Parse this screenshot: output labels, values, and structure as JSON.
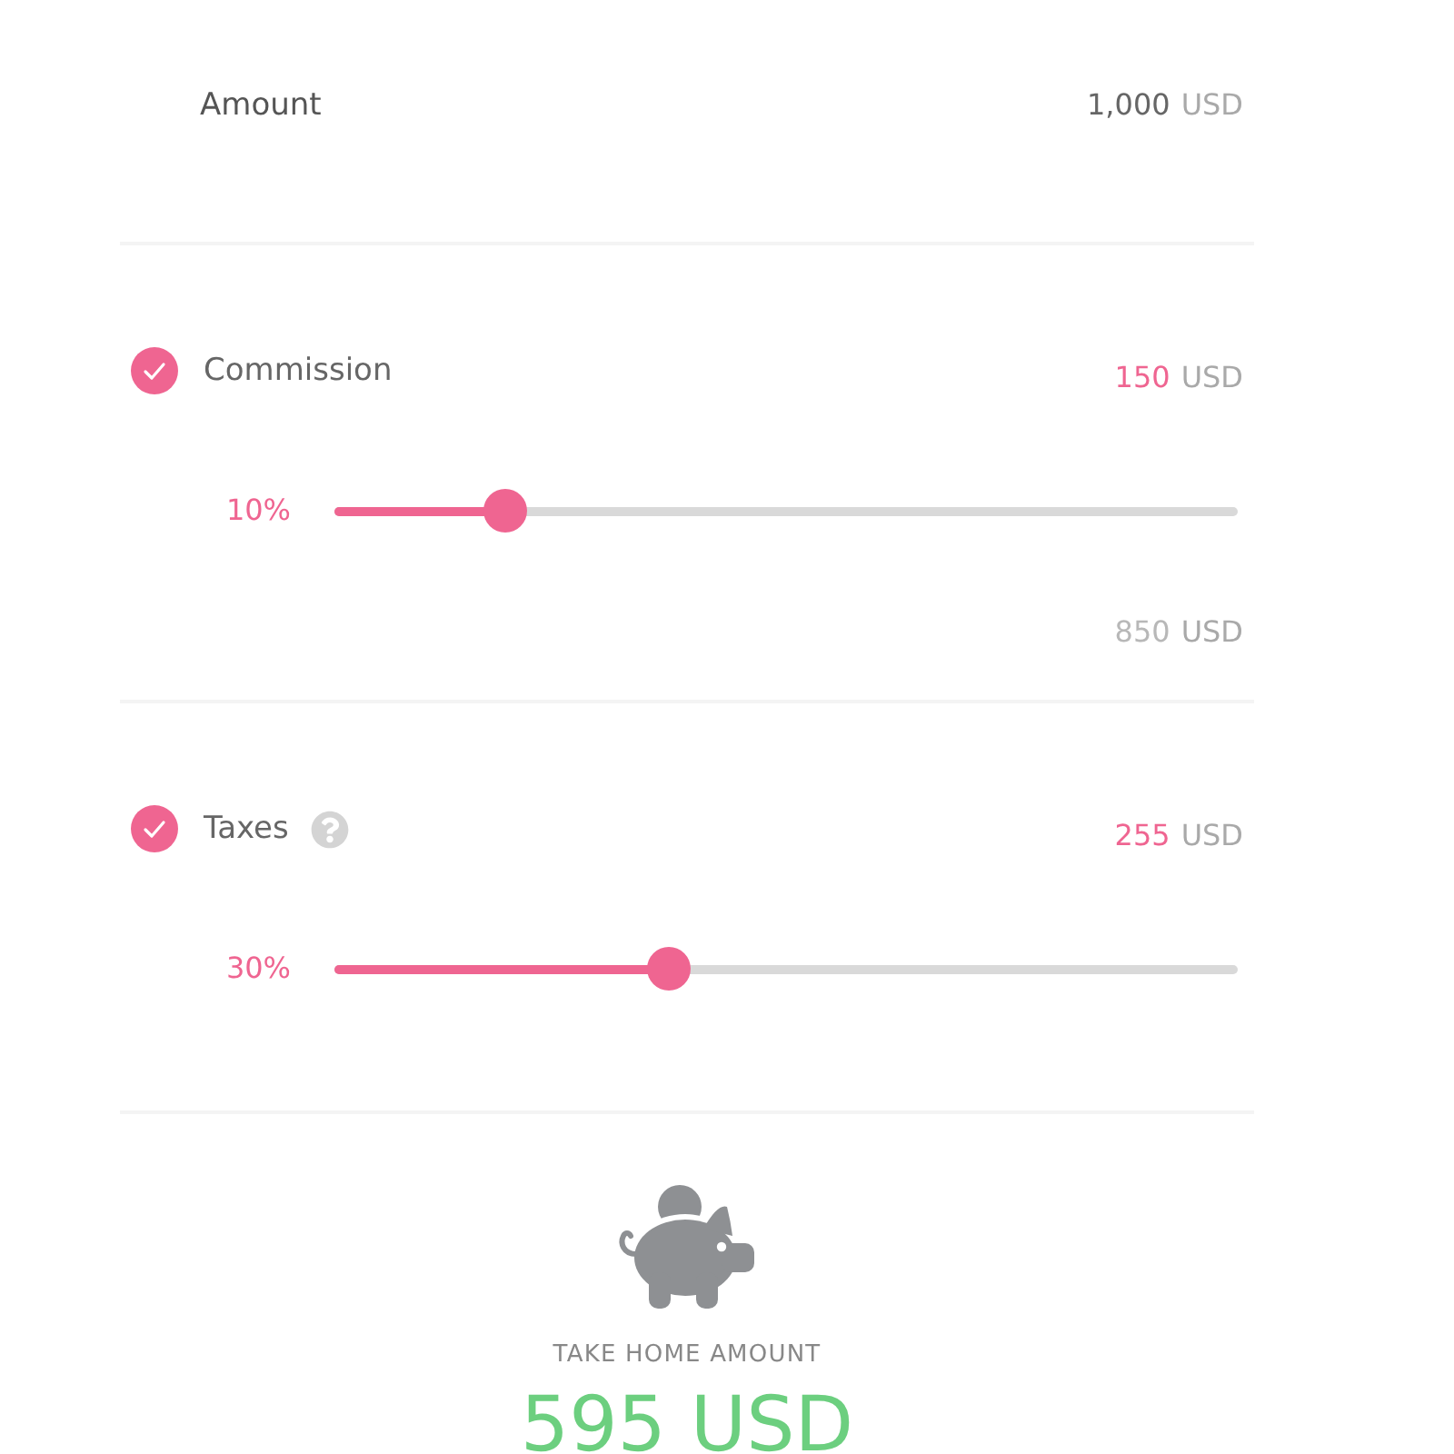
{
  "amount": {
    "label": "Amount",
    "value": "1,000",
    "currency": "USD"
  },
  "deductions": [
    {
      "label": "Commission",
      "checked": true,
      "help": false,
      "value": "150",
      "currency": "USD",
      "percent": "10%",
      "level": 0.19,
      "remaining": {
        "value": "850",
        "currency": "USD"
      }
    },
    {
      "label": "Taxes",
      "checked": true,
      "help": true,
      "value": "255",
      "currency": "USD",
      "percent": "30%",
      "level": 0.37
    }
  ],
  "take_home": {
    "label": "TAKE HOME AMOUNT",
    "value": "595 USD"
  }
}
